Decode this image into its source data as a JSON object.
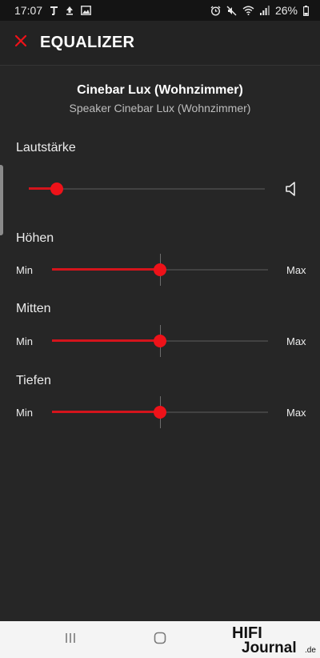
{
  "status_bar": {
    "time": "17:07",
    "battery": "26%"
  },
  "app_bar": {
    "title": "EQUALIZER"
  },
  "device": {
    "name": "Cinebar Lux (Wohnzimmer)",
    "subtitle": "Speaker Cinebar Lux (Wohnzimmer)"
  },
  "volume": {
    "label": "Lautstärke",
    "level": 0.12
  },
  "eq": [
    {
      "label": "Höhen",
      "min_label": "Min",
      "max_label": "Max",
      "level": 0.5
    },
    {
      "label": "Mitten",
      "min_label": "Min",
      "max_label": "Max",
      "level": 0.5
    },
    {
      "label": "Tiefen",
      "min_label": "Min",
      "max_label": "Max",
      "level": 0.5
    }
  ],
  "watermark": {
    "text": "HIFI Journal.de"
  },
  "colors": {
    "accent": "#ee1219",
    "background": "#262626",
    "track": "#424242"
  },
  "icons": {
    "close": "close-icon",
    "volume": "speaker-icon",
    "recents": "recents-icon",
    "home": "home-icon"
  }
}
